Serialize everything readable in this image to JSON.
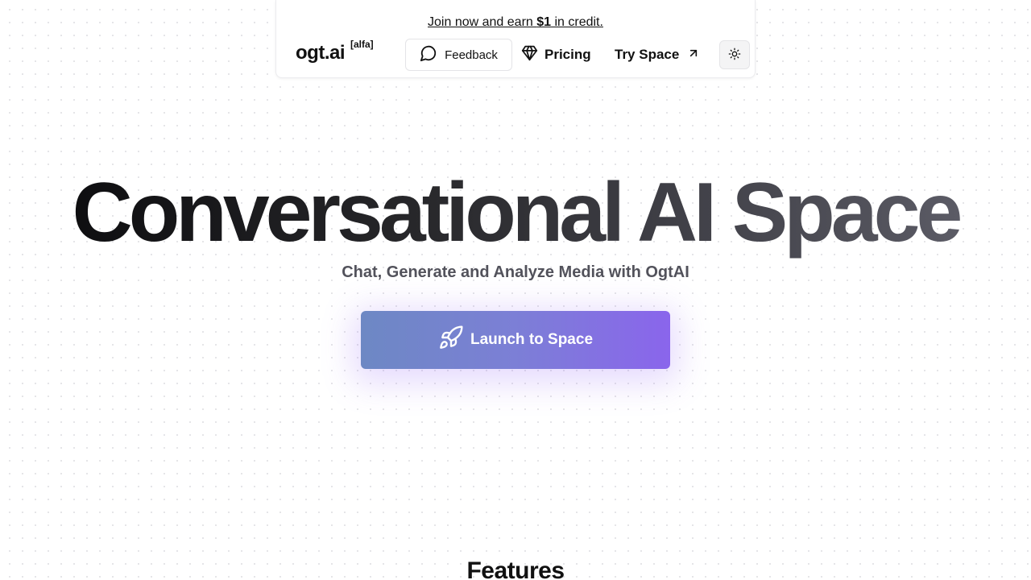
{
  "header": {
    "promo": {
      "prefix": "Join now and earn ",
      "amount": "$1",
      "suffix": " in credit."
    },
    "logo": "ogt.ai",
    "logo_badge": "[alfa]",
    "feedback_label": "Feedback",
    "pricing_label": "Pricing",
    "try_space_label": "Try Space",
    "icons": {
      "feedback": "chat-bubble-icon",
      "pricing": "diamond-icon",
      "try_space": "arrow-up-right-icon",
      "theme": "sun-icon"
    }
  },
  "hero": {
    "title": "Conversational AI Space",
    "subtitle": "Chat, Generate and Analyze Media with OgtAI",
    "cta_label": "Launch to Space",
    "cta_icon": "rocket-icon"
  },
  "features": {
    "title": "Features"
  },
  "colors": {
    "accent_start": "#6d88c4",
    "accent_end": "#8a65ec",
    "subtitle": "#52525b"
  }
}
